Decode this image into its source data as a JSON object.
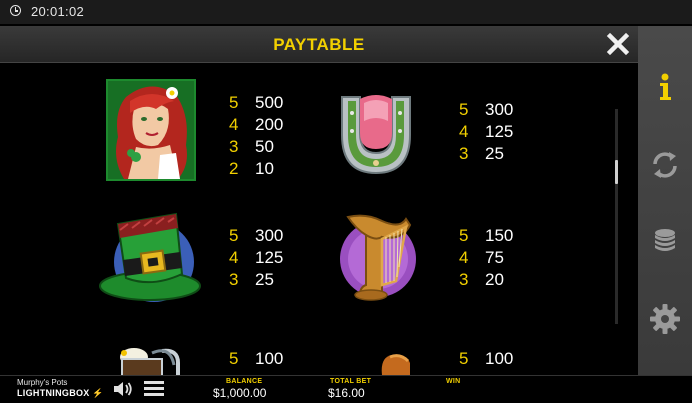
{
  "status": {
    "time": "20:01:02"
  },
  "header": {
    "title": "PAYTABLE",
    "close_icon": "close-icon"
  },
  "paytable": [
    {
      "symbol": "red-haired-lady",
      "pays": [
        {
          "count": "5",
          "value": "500"
        },
        {
          "count": "4",
          "value": "200"
        },
        {
          "count": "3",
          "value": "50"
        },
        {
          "count": "2",
          "value": "10"
        }
      ]
    },
    {
      "symbol": "horseshoe",
      "pays": [
        {
          "count": "5",
          "value": "300"
        },
        {
          "count": "4",
          "value": "125"
        },
        {
          "count": "3",
          "value": "25"
        }
      ]
    },
    {
      "symbol": "leprechaun-hat",
      "pays": [
        {
          "count": "5",
          "value": "300"
        },
        {
          "count": "4",
          "value": "125"
        },
        {
          "count": "3",
          "value": "25"
        }
      ]
    },
    {
      "symbol": "harp",
      "pays": [
        {
          "count": "5",
          "value": "150"
        },
        {
          "count": "4",
          "value": "75"
        },
        {
          "count": "3",
          "value": "20"
        }
      ]
    },
    {
      "symbol": "beer-mug",
      "pays": [
        {
          "count": "5",
          "value": "100"
        }
      ]
    },
    {
      "symbol": "boot",
      "pays": [
        {
          "count": "5",
          "value": "100"
        }
      ]
    }
  ],
  "side_panel": [
    "info-icon",
    "refresh-icon",
    "coins-icon",
    "gear-icon"
  ],
  "footer": {
    "game_name": "Murphy's Pots",
    "brand_prefix": "LIGHTNING",
    "brand_suffix": "BOX",
    "balance_label": "BALANCE",
    "balance_value": "$1,000.00",
    "total_bet_label": "TOTAL BET",
    "total_bet_value": "$16.00",
    "win_label": "WIN",
    "win_value": ""
  },
  "colors": {
    "accent": "#f2d000",
    "background": "#000000",
    "panel": "#3a3a3a"
  }
}
